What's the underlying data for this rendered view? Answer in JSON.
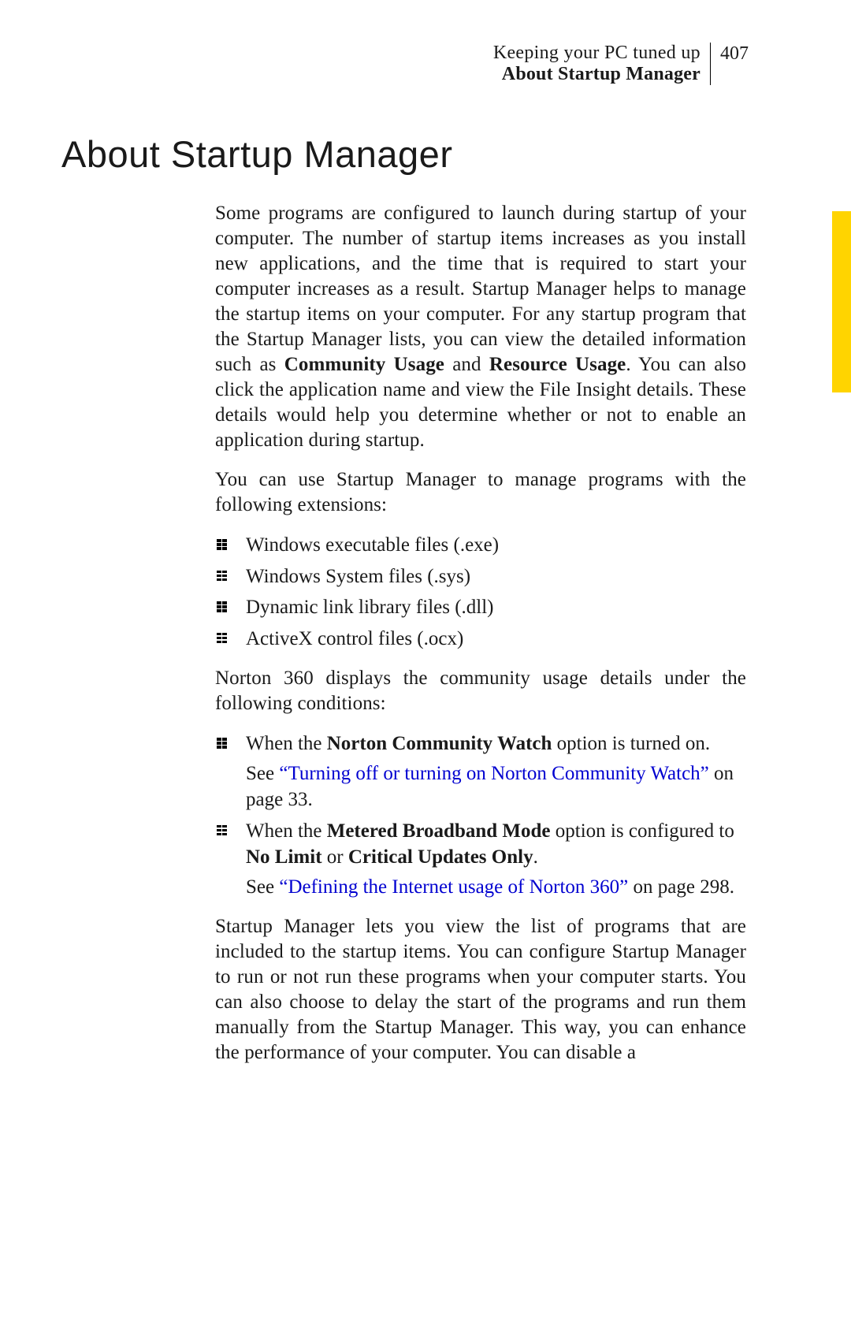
{
  "header": {
    "chapter": "Keeping your PC tuned up",
    "section": "About Startup Manager",
    "page": "407"
  },
  "title": "About Startup Manager",
  "paragraphs": {
    "intro": {
      "p1a": "Some programs are configured to launch during startup of your computer. The number of startup items increases as you install new applications, and the time that is required to start your computer increases as a result. Startup Manager helps to manage the startup items on your computer. For any startup program that the Startup Manager lists, you can view the detailed information such as ",
      "b1": "Community Usage",
      "p1b": " and ",
      "b2": "Resource Usage",
      "p1c": ". You can also click the application name and view the File Insight details. These details would help you determine whether or not to enable an application during startup."
    },
    "extensions_intro": "You can use Startup Manager to manage programs with the following extensions:",
    "conditions_intro": "Norton 360 displays the community usage details under the following conditions:",
    "closing": "Startup Manager lets you view the list of programs that are included to the startup items. You can configure Startup Manager to run or not run these programs when your computer starts. You can also choose to delay the start of the programs and run them manually from the Startup Manager. This way, you can enhance the performance of your computer. You can disable a"
  },
  "lists": {
    "extensions": [
      "Windows executable files (.exe)",
      "Windows System files (.sys)",
      "Dynamic link library files (.dll)",
      "ActiveX control files (.ocx)"
    ],
    "conditions": [
      {
        "pre": "When the ",
        "bold1": "Norton Community Watch",
        "post": " option is turned on.",
        "see_pre": "See ",
        "link": "“Turning off or turning on Norton Community Watch”",
        "see_post": " on page 33."
      },
      {
        "pre": "When the ",
        "bold1": "Metered Broadband Mode",
        "mid1": " option is configured to ",
        "bold2": "No Limit",
        "mid2": " or ",
        "bold3": "Critical Updates Only",
        "post": ".",
        "see_pre": "See ",
        "link": "“Defining the Internet usage of Norton 360”",
        "see_post": " on page 298."
      }
    ]
  }
}
